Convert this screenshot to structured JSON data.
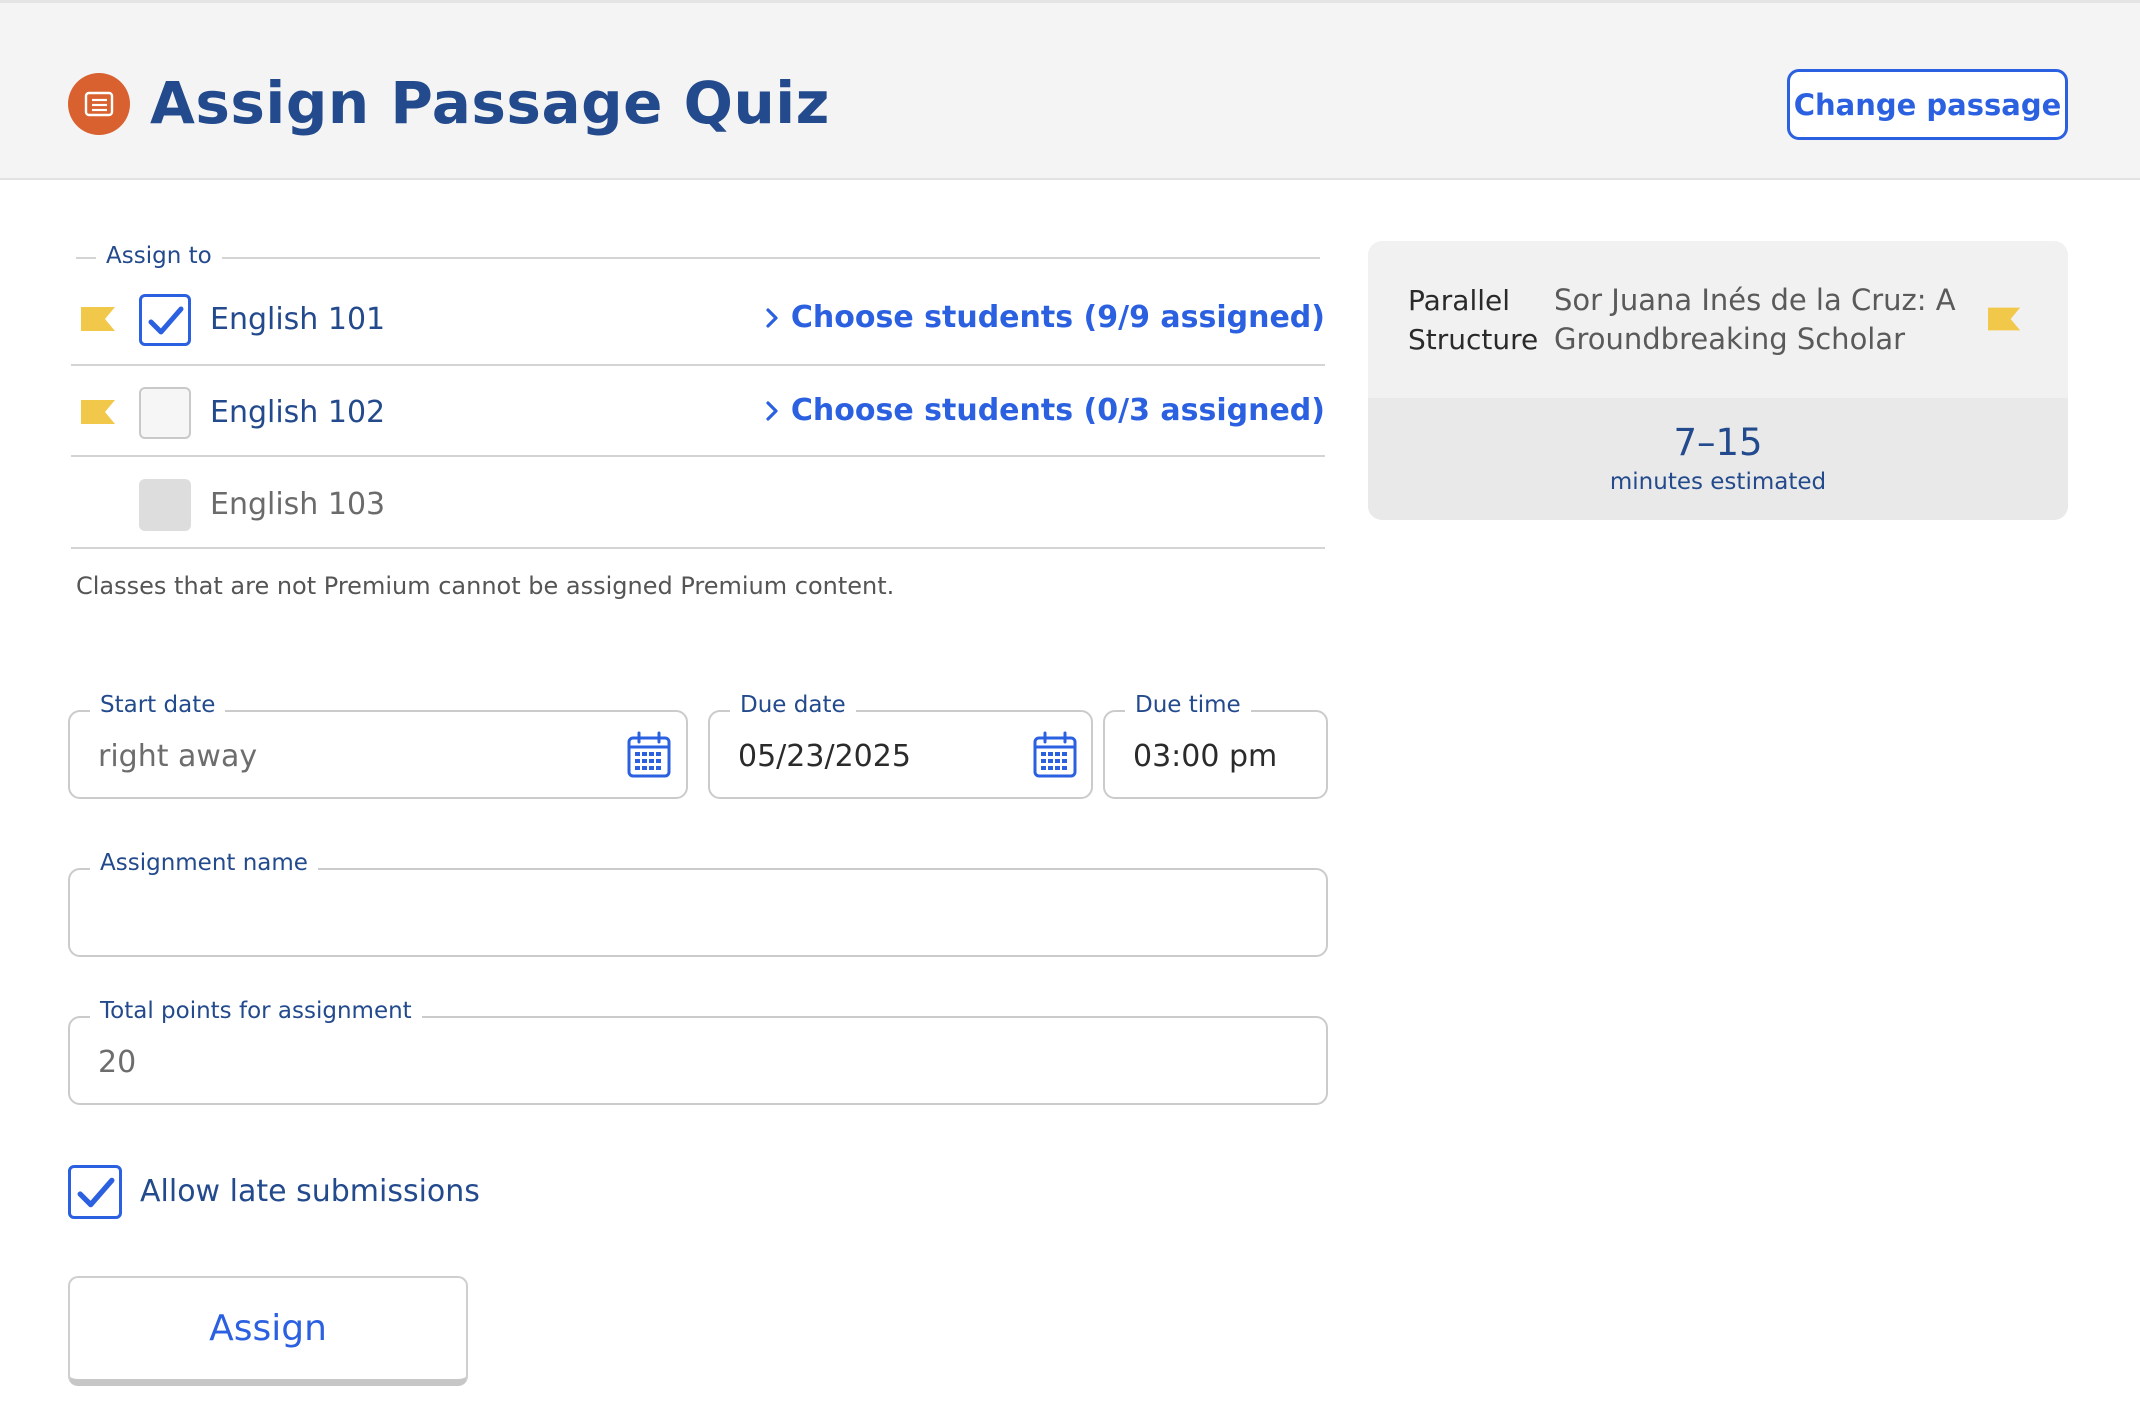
{
  "header": {
    "title": "Assign Passage Quiz",
    "change_passage_label": "Change passage",
    "icon": "newspaper-icon",
    "icon_color": "#d9602f"
  },
  "assign_to": {
    "legend": "Assign to",
    "classes": [
      {
        "name": "English 101",
        "checked": true,
        "premium_flag": true,
        "choose_label": "Choose students (9/9 assigned)"
      },
      {
        "name": "English 102",
        "checked": false,
        "premium_flag": true,
        "choose_label": "Choose students (0/3 assigned)"
      },
      {
        "name": "English 103",
        "checked": false,
        "disabled": true,
        "premium_flag": false
      }
    ],
    "note": "Classes that are not Premium cannot be assigned Premium content."
  },
  "passage_card": {
    "skill": "Parallel Structure",
    "passage_title": "Sor Juana Inés de la Cruz: A Groundbreaking Scholar",
    "minutes": "7–15",
    "minutes_label": "minutes estimated"
  },
  "form": {
    "start_date": {
      "label": "Start date",
      "placeholder": "right away"
    },
    "due_date": {
      "label": "Due date",
      "value": "05/23/2025"
    },
    "due_time": {
      "label": "Due time",
      "value": "03:00 pm"
    },
    "assignment_name": {
      "label": "Assignment name",
      "value": ""
    },
    "total_points": {
      "label": "Total points for assignment",
      "value": "20"
    },
    "allow_late": {
      "label": "Allow late submissions",
      "checked": true
    },
    "assign_label": "Assign"
  },
  "colors": {
    "accent": "#2b61e0",
    "navy": "#234a8c",
    "premium_flag": "#f2c84b"
  }
}
